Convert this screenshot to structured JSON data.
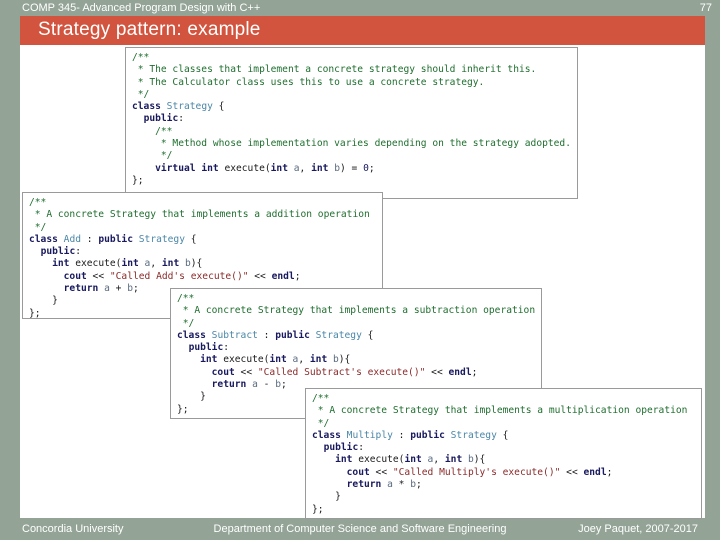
{
  "header": {
    "course_label": "COMP 345- Advanced Program Design with C++",
    "page_number": "77",
    "title": "Strategy pattern: example",
    "accent_color": "#d2543e",
    "chrome_color": "#93a396"
  },
  "footer": {
    "left": "Concordia University",
    "center": "Department of Computer Science and Software Engineering",
    "right": "Joey Paquet, 2007-2017"
  },
  "code_blocks": [
    {
      "name": "strategy-base-class",
      "lines": [
        "/**",
        " * The classes that implement a concrete strategy should inherit this.",
        " * The Calculator class uses this to use a concrete strategy.",
        " */",
        "class Strategy {",
        "  public:",
        "    /**",
        "     * Method whose implementation varies depending on the strategy adopted.",
        "     */",
        "    virtual int execute(int a, int b) = 0;",
        "};"
      ]
    },
    {
      "name": "add-class",
      "lines": [
        "/**",
        " * A concrete Strategy that implements a addition operation",
        " */",
        "class Add : public Strategy {",
        "  public:",
        "    int execute(int a, int b){",
        "      cout << \"Called Add's execute()\" << endl;",
        "      return a + b;",
        "    }",
        "};"
      ]
    },
    {
      "name": "subtract-class",
      "lines": [
        "/**",
        " * A concrete Strategy that implements a subtraction operation",
        " */",
        "class Subtract : public Strategy {",
        "  public:",
        "    int execute(int a, int b){",
        "      cout << \"Called Subtract's execute()\" << endl;",
        "      return a - b;",
        "    }",
        "};"
      ]
    },
    {
      "name": "multiply-class",
      "lines": [
        "/**",
        " * A concrete Strategy that implements a multiplication operation",
        " */",
        "class Multiply : public Strategy {",
        "  public:",
        "    int execute(int a, int b){",
        "      cout << \"Called Multiply's execute()\" << endl;",
        "      return a * b;",
        "    }",
        "};"
      ]
    }
  ]
}
